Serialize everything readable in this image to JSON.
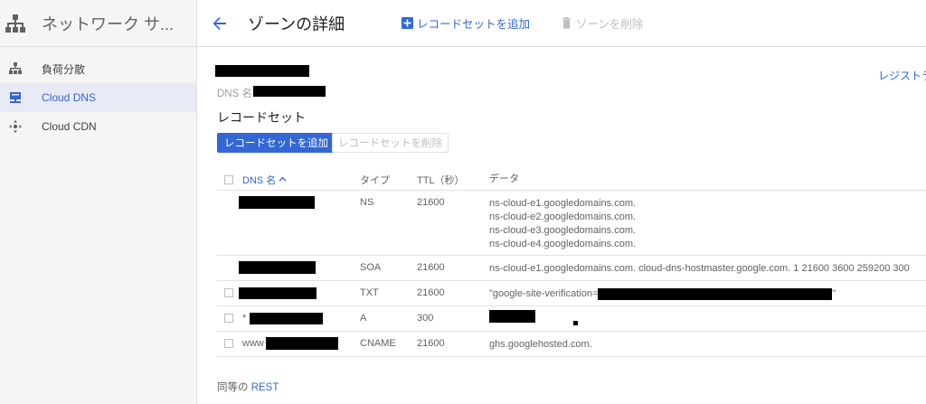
{
  "sidebar": {
    "product_title": "ネットワーク サ...",
    "items": [
      {
        "label": "負荷分散",
        "icon": "load-balancing-icon",
        "active": false
      },
      {
        "label": "Cloud DNS",
        "icon": "cloud-dns-icon",
        "active": true
      },
      {
        "label": "Cloud CDN",
        "icon": "cloud-cdn-icon",
        "active": false
      }
    ]
  },
  "header": {
    "title": "ゾーンの詳細",
    "add_record_set": "レコードセットを追加",
    "delete_zone": "ゾーンを削除"
  },
  "zone": {
    "dns_name_label": "DNS 名",
    "registrar_link": "レジストラ"
  },
  "record_sets": {
    "title": "レコードセット",
    "add_button": "レコードセットを追加",
    "delete_button": "レコードセットを削除",
    "columns": {
      "name": "DNS 名",
      "type": "タイプ",
      "ttl": "TTL（秒）",
      "data": "データ"
    },
    "rows": [
      {
        "name_prefix": "",
        "type": "NS",
        "ttl": "21600",
        "data": [
          "ns-cloud-e1.googledomains.com.",
          "ns-cloud-e2.googledomains.com.",
          "ns-cloud-e3.googledomains.com.",
          "ns-cloud-e4.googledomains.com."
        ]
      },
      {
        "name_prefix": "",
        "type": "SOA",
        "ttl": "21600",
        "data": [
          "ns-cloud-e1.googledomains.com. cloud-dns-hostmaster.google.com. 1 21600 3600 259200 300"
        ]
      },
      {
        "name_prefix": "",
        "type": "TXT",
        "ttl": "21600",
        "data_prefix": "\"google-site-verification=",
        "data_suffix": "\""
      },
      {
        "name_prefix": "*",
        "type": "A",
        "ttl": "300"
      },
      {
        "name_prefix": "www",
        "type": "CNAME",
        "ttl": "21600",
        "data": [
          "ghs.googlehosted.com."
        ]
      }
    ]
  },
  "footer": {
    "equivalent_label": "同等の",
    "rest_link": "REST"
  },
  "colors": {
    "accent": "#3367d6",
    "sidebar_bg": "#f5f5f5",
    "active_bg": "#e8eaf6"
  }
}
